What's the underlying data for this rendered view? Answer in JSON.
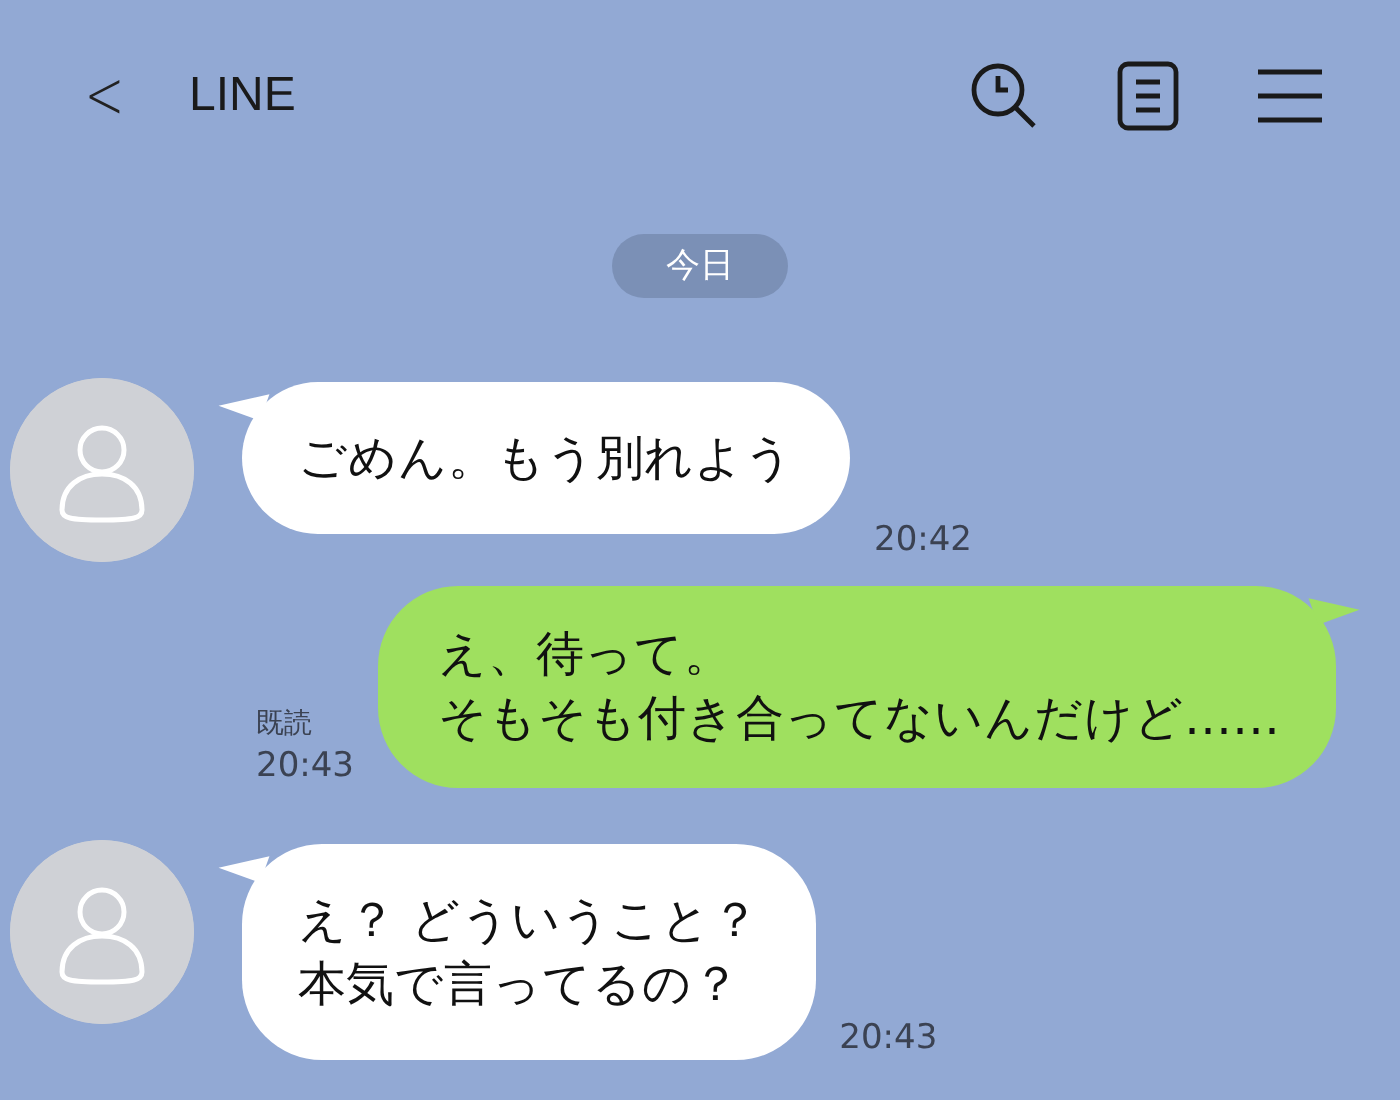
{
  "header": {
    "back": "<",
    "title": "LINE"
  },
  "date_label": "今日",
  "messages": [
    {
      "kind": "incoming",
      "lines": [
        "ごめん。もう別れよう"
      ],
      "time": "20:42"
    },
    {
      "kind": "outgoing",
      "lines": [
        "え、待って。",
        "そもそも付き合ってないんだけど……"
      ],
      "read_label": "既読",
      "time": "20:43"
    },
    {
      "kind": "incoming",
      "lines": [
        "え？ どういうこと？",
        "本気で言ってるの？"
      ],
      "time": "20:43"
    }
  ]
}
